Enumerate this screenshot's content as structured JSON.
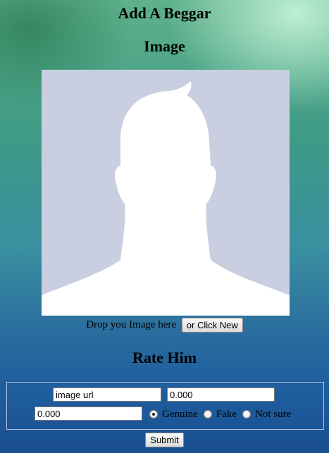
{
  "header": {
    "title_line_1": "Add A Beggar",
    "title_line_2": "Image"
  },
  "image_area": {
    "placeholder_icon": "default-avatar-silhouette-icon",
    "drop_text": "Drop you Image here",
    "click_new_label": "or Click New"
  },
  "rate_section": {
    "title": "Rate Him",
    "image_url_value": "image url",
    "rating_value_1": "0.000",
    "rating_value_2": "0.000",
    "radio_options": [
      {
        "label": "Genuine",
        "checked": true
      },
      {
        "label": "Fake",
        "checked": false
      },
      {
        "label": "Not sure",
        "checked": false
      }
    ],
    "submit_label": "Submit"
  },
  "colors": {
    "avatar_background": "#c9cfe0",
    "avatar_silhouette": "#ffffff"
  }
}
